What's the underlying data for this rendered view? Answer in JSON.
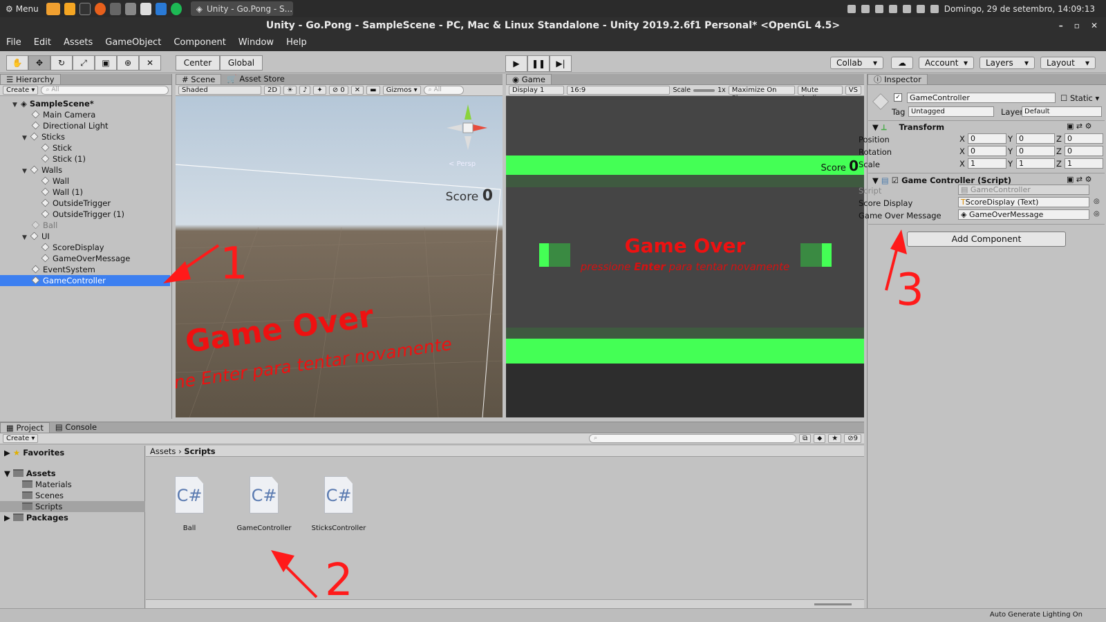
{
  "taskbar": {
    "menu": "Menu",
    "window": "Unity - Go.Pong - S...",
    "datetime": "Domingo, 29 de setembro, 14:09:13"
  },
  "titlebar": {
    "title": "Unity - Go.Pong - SampleScene - PC, Mac & Linux Standalone - Unity 2019.2.6f1 Personal* <OpenGL 4.5>"
  },
  "menubar": [
    "File",
    "Edit",
    "Assets",
    "GameObject",
    "Component",
    "Window",
    "Help"
  ],
  "toolbar": {
    "center": "Center",
    "global": "Global",
    "collab": "Collab",
    "account": "Account",
    "layers": "Layers",
    "layout": "Layout"
  },
  "hierarchy": {
    "tab": "Hierarchy",
    "create": "Create",
    "search": "All",
    "scene": "SampleScene*",
    "items": [
      "Main Camera",
      "Directional Light",
      "Sticks",
      "Stick",
      "Stick (1)",
      "Walls",
      "Wall",
      "Wall (1)",
      "OutsideTrigger",
      "OutsideTrigger (1)",
      "Ball",
      "UI",
      "ScoreDisplay",
      "GameOverMessage",
      "EventSystem",
      "GameController"
    ]
  },
  "scene": {
    "tab": "Scene",
    "tab2": "Asset Store",
    "shading": "Shaded",
    "mode2d": "2D",
    "gizmo_count": "0",
    "gizmos": "Gizmos",
    "search": "All",
    "persp": "Persp",
    "score_label": "Score",
    "score_value": "0",
    "gameover": "Game Over",
    "gameover_sub": "ne Enter para tentar novamente"
  },
  "game": {
    "tab": "Game",
    "display": "Display 1",
    "aspect": "16:9",
    "scale_label": "Scale",
    "scale_value": "1x",
    "maximize": "Maximize On Play",
    "mute": "Mute Audio",
    "vs": "VS",
    "score_label": "Score",
    "score_value": "0",
    "gameover": "Game Over",
    "sub_pre": "pressione ",
    "sub_key": "Enter",
    "sub_post": " para tentar novamente"
  },
  "inspector": {
    "tab": "Inspector",
    "object": "GameController",
    "static": "Static",
    "tag_label": "Tag",
    "tag": "Untagged",
    "layer_label": "Layer",
    "layer": "Default",
    "transform": "Transform",
    "position": "Position",
    "rotation": "Rotation",
    "scale": "Scale",
    "axes": [
      "X",
      "Y",
      "Z"
    ],
    "pos": [
      "0",
      "0",
      "0"
    ],
    "rot": [
      "0",
      "0",
      "0"
    ],
    "scl": [
      "1",
      "1",
      "1"
    ],
    "component": "Game Controller (Script)",
    "script_label": "Script",
    "script_value": "GameController",
    "score_display_label": "Score Display",
    "score_display_value": "ScoreDisplay (Text)",
    "gom_label": "Game Over Message",
    "gom_value": "GameOverMessage",
    "add_component": "Add Component"
  },
  "project": {
    "tab": "Project",
    "tab2": "Console",
    "create": "Create",
    "favorites": "Favorites",
    "assets": "Assets",
    "folders": [
      "Materials",
      "Scenes",
      "Scripts"
    ],
    "packages": "Packages",
    "hidden_count": "9",
    "crumb1": "Assets",
    "crumb2": "Scripts",
    "files": [
      "Ball",
      "GameController",
      "SticksController"
    ],
    "file_ext": "C#"
  },
  "status": {
    "text": "Auto Generate Lighting On"
  },
  "annotations": [
    "1",
    "2",
    "3"
  ],
  "colors": {
    "selection": "#3c7ff0",
    "game_green": "#44ff55",
    "annot_red": "#ff1a1a",
    "game_bg": "#454545"
  }
}
